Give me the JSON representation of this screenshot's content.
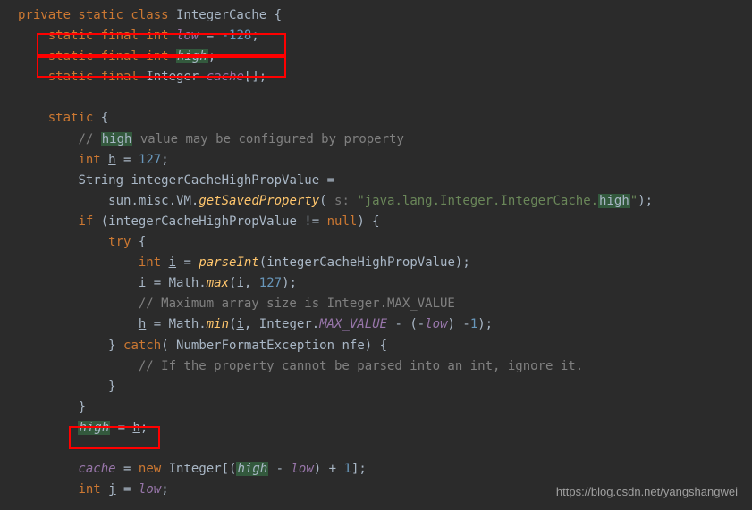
{
  "code": {
    "line1_kw1": "private static class",
    "line1_cls": " IntegerCache {",
    "line2_pad": "    ",
    "line2_kw": "static final int",
    "line2_sp": " ",
    "line2_field": "low",
    "line2_eq": " = ",
    "line2_num": "-128",
    "line2_end": ";",
    "line3_pad": "    ",
    "line3_kw": "static final int",
    "line3_sp": " ",
    "line3_field": "high",
    "line3_end": ";",
    "line4_pad": "    ",
    "line4_kw": "static final",
    "line4_sp": " ",
    "line4_cls": "Integer ",
    "line4_field": "cache",
    "line4_end": "[];",
    "line6_pad": "    ",
    "line6_kw": "static",
    "line6_end": " {",
    "line7_pad": "        ",
    "line7_cmt1": "// ",
    "line7_hl": "high",
    "line7_cmt2": " value may be configured by property",
    "line8_pad": "        ",
    "line8_kw": "int",
    "line8_sp": " ",
    "line8_var": "h",
    "line8_eq": " = ",
    "line8_num": "127",
    "line8_end": ";",
    "line9_pad": "        ",
    "line9_txt": "String integerCacheHighPropValue =",
    "line10_pad": "            ",
    "line10_txt1": "sun.misc.VM.",
    "line10_method": "getSavedProperty",
    "line10_txt2": "( ",
    "line10_param": "s: ",
    "line10_str1": "\"java.lang.Integer.IntegerCache.",
    "line10_hl": "high",
    "line10_str2": "\"",
    "line10_end": ");",
    "line11_pad": "        ",
    "line11_kw": "if",
    "line11_txt": " (integerCacheHighPropValue != ",
    "line11_null": "null",
    "line11_end": ") {",
    "line12_pad": "            ",
    "line12_kw": "try",
    "line12_end": " {",
    "line13_pad": "                ",
    "line13_kw": "int",
    "line13_sp": " ",
    "line13_var": "i",
    "line13_eq": " = ",
    "line13_method": "parseInt",
    "line13_txt": "(integerCacheHighPropValue);",
    "line14_pad": "                ",
    "line14_var": "i",
    "line14_txt1": " = Math.",
    "line14_method": "max",
    "line14_txt2": "(",
    "line14_var2": "i",
    "line14_txt3": ", ",
    "line14_num": "127",
    "line14_end": ");",
    "line15_pad": "                ",
    "line15_cmt": "// Maximum array size is Integer.MAX_VALUE",
    "line16_pad": "                ",
    "line16_var": "h",
    "line16_txt1": " = Math.",
    "line16_method": "min",
    "line16_txt2": "(",
    "line16_var2": "i",
    "line16_txt3": ", Integer.",
    "line16_const": "MAX_VALUE",
    "line16_txt4": " - (-",
    "line16_field": "low",
    "line16_txt5": ") -",
    "line16_num": "1",
    "line16_end": ");",
    "line17_pad": "            ",
    "line17_txt1": "} ",
    "line17_kw": "catch",
    "line17_txt2": "( NumberFormatException nfe) {",
    "line18_pad": "                ",
    "line18_cmt": "// If the property cannot be parsed into an int, ignore it.",
    "line19_pad": "            ",
    "line19_txt": "}",
    "line20_pad": "        ",
    "line20_txt": "}",
    "line21_pad": "        ",
    "line21_field": "high",
    "line21_eq": " = ",
    "line21_var": "h",
    "line21_end": ";",
    "line23_pad": "        ",
    "line23_field": "cache",
    "line23_eq": " = ",
    "line23_kw": "new",
    "line23_txt1": " Integer[(",
    "line23_field2": "high",
    "line23_txt2": " - ",
    "line23_field3": "low",
    "line23_txt3": ") + ",
    "line23_num": "1",
    "line23_end": "];",
    "line24_pad": "        ",
    "line24_kw": "int",
    "line24_sp": " ",
    "line24_var": "j",
    "line24_eq": " = ",
    "line24_field": "low",
    "line24_end": ";"
  },
  "watermark": "https://blog.csdn.net/yangshangwei"
}
